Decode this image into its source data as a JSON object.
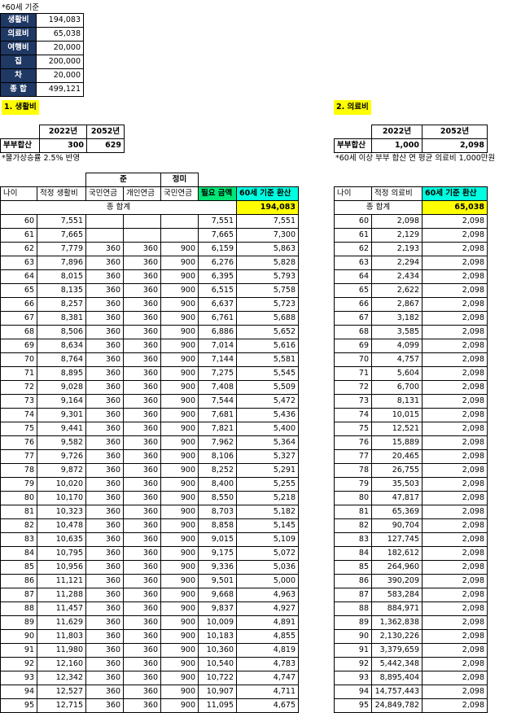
{
  "header_note": "*60세 기준",
  "summary": [
    {
      "label": "생활비",
      "value": "194,083"
    },
    {
      "label": "의료비",
      "value": "65,038"
    },
    {
      "label": "여행비",
      "value": "20,000"
    },
    {
      "label": "집",
      "value": "200,000"
    },
    {
      "label": "차",
      "value": "20,000"
    },
    {
      "label": "종 합",
      "value": "499,121"
    }
  ],
  "living": {
    "title": "1. 생활비",
    "year_headers": [
      "2022년",
      "2052년"
    ],
    "couple_label": "부부합산",
    "couple_values": [
      "300",
      "629"
    ],
    "note": "*물가상승률 2.5% 반영",
    "group_headers": {
      "jun": "준",
      "jeongmi": "정미"
    },
    "columns": [
      "나이",
      "적정 생활비",
      "국민연금",
      "개인연금",
      "국민연금",
      "필요 금액",
      "60세 기준 환산"
    ],
    "total_label": "종 합계",
    "total_value": "194,083",
    "rows": [
      [
        "60",
        "7,551",
        "",
        "",
        "",
        "7,551",
        "7,551"
      ],
      [
        "61",
        "7,665",
        "",
        "",
        "",
        "7,665",
        "7,300"
      ],
      [
        "62",
        "7,779",
        "360",
        "360",
        "900",
        "6,159",
        "5,863"
      ],
      [
        "63",
        "7,896",
        "360",
        "360",
        "900",
        "6,276",
        "5,828"
      ],
      [
        "64",
        "8,015",
        "360",
        "360",
        "900",
        "6,395",
        "5,793"
      ],
      [
        "65",
        "8,135",
        "360",
        "360",
        "900",
        "6,515",
        "5,758"
      ],
      [
        "66",
        "8,257",
        "360",
        "360",
        "900",
        "6,637",
        "5,723"
      ],
      [
        "67",
        "8,381",
        "360",
        "360",
        "900",
        "6,761",
        "5,688"
      ],
      [
        "68",
        "8,506",
        "360",
        "360",
        "900",
        "6,886",
        "5,652"
      ],
      [
        "69",
        "8,634",
        "360",
        "360",
        "900",
        "7,014",
        "5,616"
      ],
      [
        "70",
        "8,764",
        "360",
        "360",
        "900",
        "7,144",
        "5,581"
      ],
      [
        "71",
        "8,895",
        "360",
        "360",
        "900",
        "7,275",
        "5,545"
      ],
      [
        "72",
        "9,028",
        "360",
        "360",
        "900",
        "7,408",
        "5,509"
      ],
      [
        "73",
        "9,164",
        "360",
        "360",
        "900",
        "7,544",
        "5,472"
      ],
      [
        "74",
        "9,301",
        "360",
        "360",
        "900",
        "7,681",
        "5,436"
      ],
      [
        "75",
        "9,441",
        "360",
        "360",
        "900",
        "7,821",
        "5,400"
      ],
      [
        "76",
        "9,582",
        "360",
        "360",
        "900",
        "7,962",
        "5,364"
      ],
      [
        "77",
        "9,726",
        "360",
        "360",
        "900",
        "8,106",
        "5,327"
      ],
      [
        "78",
        "9,872",
        "360",
        "360",
        "900",
        "8,252",
        "5,291"
      ],
      [
        "79",
        "10,020",
        "360",
        "360",
        "900",
        "8,400",
        "5,255"
      ],
      [
        "80",
        "10,170",
        "360",
        "360",
        "900",
        "8,550",
        "5,218"
      ],
      [
        "81",
        "10,323",
        "360",
        "360",
        "900",
        "8,703",
        "5,182"
      ],
      [
        "82",
        "10,478",
        "360",
        "360",
        "900",
        "8,858",
        "5,145"
      ],
      [
        "83",
        "10,635",
        "360",
        "360",
        "900",
        "9,015",
        "5,109"
      ],
      [
        "84",
        "10,795",
        "360",
        "360",
        "900",
        "9,175",
        "5,072"
      ],
      [
        "85",
        "10,956",
        "360",
        "360",
        "900",
        "9,336",
        "5,036"
      ],
      [
        "86",
        "11,121",
        "360",
        "360",
        "900",
        "9,501",
        "5,000"
      ],
      [
        "87",
        "11,288",
        "360",
        "360",
        "900",
        "9,668",
        "4,963"
      ],
      [
        "88",
        "11,457",
        "360",
        "360",
        "900",
        "9,837",
        "4,927"
      ],
      [
        "89",
        "11,629",
        "360",
        "360",
        "900",
        "10,009",
        "4,891"
      ],
      [
        "90",
        "11,803",
        "360",
        "360",
        "900",
        "10,183",
        "4,855"
      ],
      [
        "91",
        "11,980",
        "360",
        "360",
        "900",
        "10,360",
        "4,819"
      ],
      [
        "92",
        "12,160",
        "360",
        "360",
        "900",
        "10,540",
        "4,783"
      ],
      [
        "93",
        "12,342",
        "360",
        "360",
        "900",
        "10,722",
        "4,747"
      ],
      [
        "94",
        "12,527",
        "360",
        "360",
        "900",
        "10,907",
        "4,711"
      ],
      [
        "95",
        "12,715",
        "360",
        "360",
        "900",
        "11,095",
        "4,675"
      ]
    ]
  },
  "medical": {
    "title": "2. 의료비",
    "year_headers": [
      "2022년",
      "2052년"
    ],
    "couple_label": "부부합산",
    "couple_values": [
      "1,000",
      "2,098"
    ],
    "note": "*60세 이상 부부 합산 연 평균 의료비 1,000만원",
    "columns": [
      "나이",
      "적정 의료비",
      "60세 기준 환산"
    ],
    "total_label": "종 합계",
    "total_value": "65,038",
    "rows": [
      [
        "60",
        "2,098",
        "2,098"
      ],
      [
        "61",
        "2,129",
        "2,098"
      ],
      [
        "62",
        "2,193",
        "2,098"
      ],
      [
        "63",
        "2,294",
        "2,098"
      ],
      [
        "64",
        "2,434",
        "2,098"
      ],
      [
        "65",
        "2,622",
        "2,098"
      ],
      [
        "66",
        "2,867",
        "2,098"
      ],
      [
        "67",
        "3,182",
        "2,098"
      ],
      [
        "68",
        "3,585",
        "2,098"
      ],
      [
        "69",
        "4,099",
        "2,098"
      ],
      [
        "70",
        "4,757",
        "2,098"
      ],
      [
        "71",
        "5,604",
        "2,098"
      ],
      [
        "72",
        "6,700",
        "2,098"
      ],
      [
        "73",
        "8,131",
        "2,098"
      ],
      [
        "74",
        "10,015",
        "2,098"
      ],
      [
        "75",
        "12,521",
        "2,098"
      ],
      [
        "76",
        "15,889",
        "2,098"
      ],
      [
        "77",
        "20,465",
        "2,098"
      ],
      [
        "78",
        "26,755",
        "2,098"
      ],
      [
        "79",
        "35,503",
        "2,098"
      ],
      [
        "80",
        "47,817",
        "2,098"
      ],
      [
        "81",
        "65,369",
        "2,098"
      ],
      [
        "82",
        "90,704",
        "2,098"
      ],
      [
        "83",
        "127,745",
        "2,098"
      ],
      [
        "84",
        "182,612",
        "2,098"
      ],
      [
        "85",
        "264,960",
        "2,098"
      ],
      [
        "86",
        "390,209",
        "2,098"
      ],
      [
        "87",
        "583,284",
        "2,098"
      ],
      [
        "88",
        "884,971",
        "2,098"
      ],
      [
        "89",
        "1,362,838",
        "2,098"
      ],
      [
        "90",
        "2,130,226",
        "2,098"
      ],
      [
        "91",
        "3,379,659",
        "2,098"
      ],
      [
        "92",
        "5,442,348",
        "2,098"
      ],
      [
        "93",
        "8,895,404",
        "2,098"
      ],
      [
        "94",
        "14,757,443",
        "2,098"
      ],
      [
        "95",
        "24,849,782",
        "2,098"
      ]
    ]
  }
}
